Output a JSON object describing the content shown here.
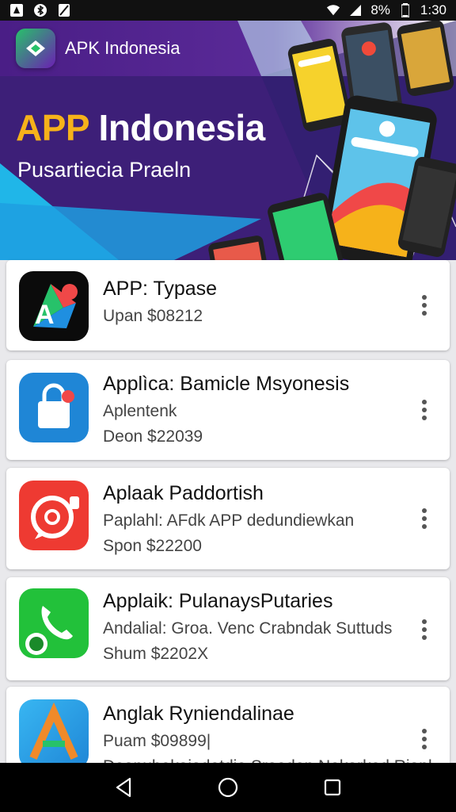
{
  "status_bar": {
    "battery": "8%",
    "time": "1:30",
    "icons": [
      "android-notification-icon",
      "bluetooth-icon",
      "no-sim-icon",
      "wifi-icon",
      "signal-icon",
      "battery-icon"
    ]
  },
  "hero": {
    "app_name": "APK Indonesia",
    "title_accent": "APP",
    "title_rest": " Indonesia",
    "subtitle": "Pusartiecia Praeln",
    "colors": {
      "accent": "#f6b21a",
      "background": "#3d1f78"
    }
  },
  "apps": [
    {
      "title": "APP: Typase",
      "lines": [
        "Upan  $08212"
      ],
      "icon": "play-store-icon"
    },
    {
      "title": "Applìca: Bamicle Msyonesis",
      "lines": [
        "Aplentenk",
        "Deon  $22039"
      ],
      "icon": "shopping-bag-icon"
    },
    {
      "title": "Aplaak Paddortish",
      "lines": [
        "Paplahl: AFdk APP dedundiewkan",
        "Spon  $22200"
      ],
      "icon": "chat-bubble-icon"
    },
    {
      "title": "Applaik: PulanaysPutaries",
      "lines": [
        "Andalial: Groa. Venc Crabndak Suttuds",
        "Shum  $2202X"
      ],
      "icon": "phone-call-icon"
    },
    {
      "title": "Anglak Ryniendalinae",
      "lines": [
        "Puam  $09899|",
        "Deanubekajadetdie Srooden Nekarked Riapl"
      ],
      "icon": "letter-a-icon"
    }
  ],
  "nav": {
    "back": "back-icon",
    "home": "home-icon",
    "recents": "recents-icon"
  }
}
